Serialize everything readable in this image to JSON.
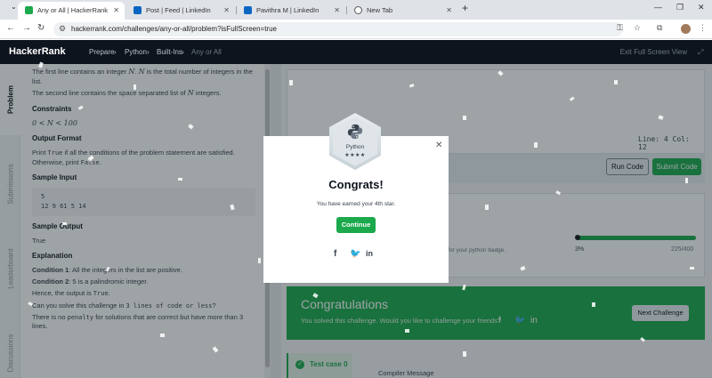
{
  "browser": {
    "tabs": [
      {
        "title": "Any or All | HackerRank",
        "active": true,
        "favicon": "hackerrank"
      },
      {
        "title": "Post | Feed | LinkedIn",
        "favicon": "linkedin"
      },
      {
        "title": "Pavithra M | LinkedIn",
        "favicon": "linkedin"
      },
      {
        "title": "New Tab",
        "favicon": "globe"
      }
    ],
    "url": "hackerrank.com/challenges/any-or-all/problem?isFullScreen=true"
  },
  "header": {
    "logo": "HackerRank",
    "nav": [
      "Prepare",
      "Python",
      "Built-Ins",
      "Any or All"
    ],
    "exit_label": "Exit Full Screen View"
  },
  "side_tabs": [
    "Problem",
    "Submissions",
    "Leaderboard",
    "Discussions"
  ],
  "problem": {
    "line1_a": "The first line contains an integer ",
    "line1_b": "N",
    "line1_c": ". ",
    "line1_d": "N",
    "line1_e": " is the total number of integers in the list.",
    "line2_a": "The second line contains the space separated list of ",
    "line2_b": "N",
    "line2_c": " integers.",
    "constraints_heading": "Constraints",
    "constraint": "0 < N < 100",
    "output_heading": "Output Format",
    "output_a": "Print ",
    "output_true": "True",
    "output_b": " if all the conditions of the problem statement are satisfied. Otherwise, print ",
    "output_false": "False",
    "output_c": ".",
    "sample_input_heading": "Sample Input",
    "sample_input": [
      "5",
      "12 9 61 5 14"
    ],
    "sample_output_heading": "Sample Output",
    "sample_output": "True",
    "explanation_heading": "Explanation",
    "cond1_label": "Condition 1",
    "cond1_text": ": All the integers in the list are positive.",
    "cond2_label": "Condition 2",
    "cond2_text": ": 5 is a palindromic integer.",
    "hence_a": "Hence, the output is ",
    "hence_b": "True",
    "hence_c": ".",
    "question_a": "Can you solve this challenge in ",
    "question_b": "3 lines of code or less",
    "question_c": "?",
    "penalty_a": "There is no ",
    "penalty_b": "penalty",
    "penalty_c": " for solutions that are correct but have more than 3 lines."
  },
  "editor": {
    "status": "Line: 4 Col: 12",
    "run_label": "Run Code",
    "submit_label": "Submit Code"
  },
  "badge_progress": {
    "text": "level for your python badge.",
    "percent_label": "3%",
    "points": "225/400",
    "fill_fraction": 0.99
  },
  "result": {
    "title": "Congratulations",
    "subtitle": "You solved this challenge. Would you like to challenge your friends?",
    "next_label": "Next Challenge",
    "testcase_label": "Test case 0",
    "compiler_label": "Compiler Message"
  },
  "modal": {
    "badge_name": "Python",
    "badge_stars": "★★★★",
    "title": "Congrats!",
    "subtitle": "You have earned your 4th star.",
    "continue_label": "Continue"
  },
  "colors": {
    "brand_green": "#1ba94c",
    "header_dark": "#0e141e"
  }
}
